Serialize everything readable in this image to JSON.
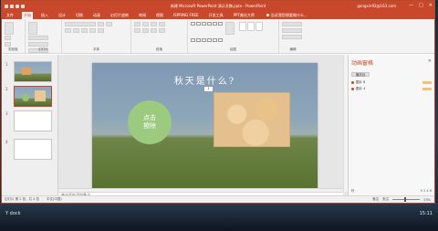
{
  "window": {
    "title": "新建 Microsoft PowerPoint 演示文稿.pptx - PowerPoint",
    "account": "gongxin92@163.com",
    "controls": [
      "—",
      "□",
      "✕"
    ]
  },
  "tabs": [
    "文件",
    "开始",
    "插入",
    "设计",
    "切换",
    "动画",
    "幻灯片放映",
    "审阅",
    "视图",
    "ISPRING FREE",
    "开发工具",
    "PPT美化大师"
  ],
  "active_tab_index": 1,
  "tell_me": "告诉我您想要做什么...",
  "ribbon_groups": [
    "剪贴板",
    "幻灯片",
    "字体",
    "段落",
    "绘图",
    "编辑"
  ],
  "slides": [
    {
      "num": "1"
    },
    {
      "num": "2"
    },
    {
      "num": "3"
    },
    {
      "num": "4"
    }
  ],
  "slide": {
    "title": "秋天是什么?",
    "circle_text_line1": "点击",
    "circle_text_line2": "擦除",
    "photo_tag": "1"
  },
  "notes_placeholder": "单击此处添加备注",
  "anim_pane": {
    "title": "动画窗格",
    "close": "✕",
    "play_label": "播放自",
    "items": [
      "图片 8",
      "图片 4"
    ],
    "footer_left": "秒",
    "footer_right": "0  2  4  6"
  },
  "statusbar": {
    "slide_info": "幻灯片 第 2 张，共 4 张",
    "language": "中文(中国)",
    "notes_btn": "备注",
    "comments_btn": "批注",
    "zoom": "53%"
  },
  "taskbar": {
    "left": "Y dock",
    "right": "15:11"
  }
}
